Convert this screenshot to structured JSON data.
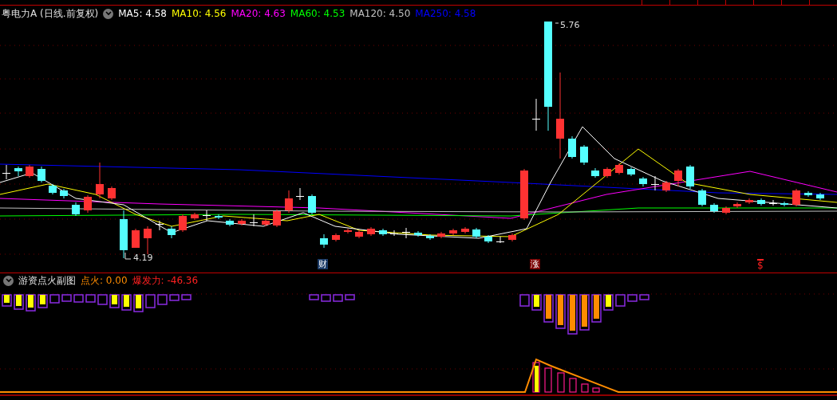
{
  "header": {
    "title": "粤电力A",
    "period": "(日线.前复权)",
    "indicators": [
      {
        "label": "MA5: 4.58",
        "color": "#ffffff"
      },
      {
        "label": "MA10: 4.56",
        "color": "#ffff00"
      },
      {
        "label": "MA20: 4.63",
        "color": "#ff00ff"
      },
      {
        "label": "MA60: 4.53",
        "color": "#00ff00"
      },
      {
        "label": "MA120: 4.50",
        "color": "#c0c0c0"
      },
      {
        "label": "MA250: 4.58",
        "color": "#0000ff"
      }
    ]
  },
  "main_chart": {
    "price_labels": [
      {
        "text": "5.76"
      },
      {
        "text": "4.19"
      }
    ],
    "event_markers": [
      {
        "text": "财",
        "kind": "box"
      },
      {
        "text": "涨",
        "kind": "box"
      },
      {
        "text": "$",
        "kind": "arrow"
      }
    ]
  },
  "sub_chart": {
    "title": "游资点火副图",
    "values": [
      {
        "label": "点火: 0.00",
        "color": "#ff8c00"
      },
      {
        "label": "爆发力: -46.36",
        "color": "#ff2020"
      }
    ]
  }
}
